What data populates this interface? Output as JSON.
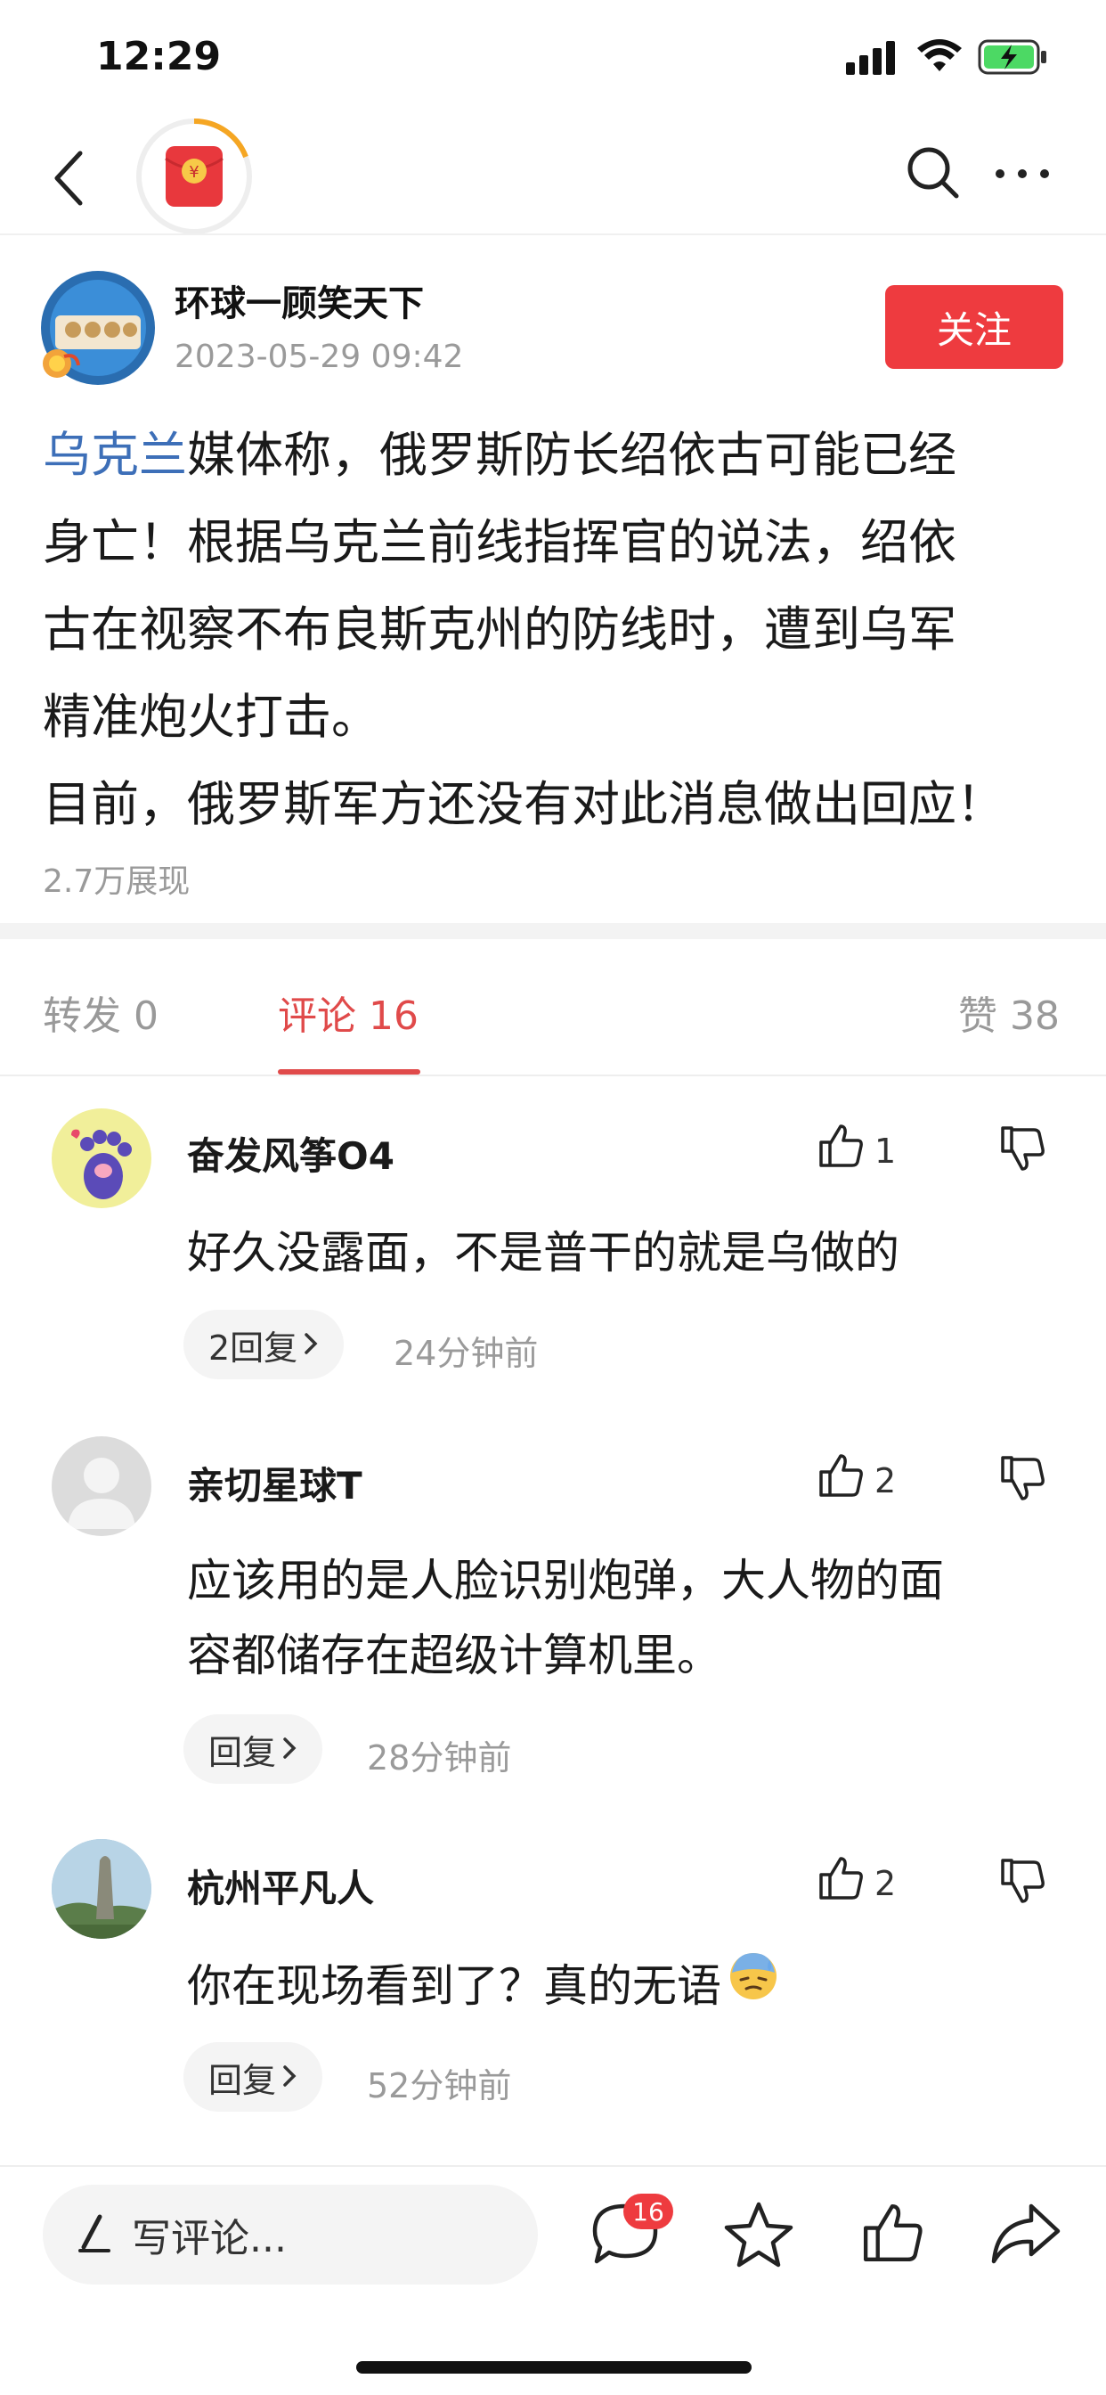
{
  "status_bar": {
    "time": "12:29"
  },
  "post": {
    "author": "环球一顾笑天下",
    "timestamp": "2023-05-29 09:42",
    "follow_label": "关注",
    "body_link": "乌克兰",
    "body_line1_rest": "媒体称，俄罗斯防长绍依古可能已经",
    "body_line2": "身亡！根据乌克兰前线指挥官的说法，绍依",
    "body_line3": "古在视察不布良斯克州的防线时，遭到乌军",
    "body_line4": "精准炮火打击。",
    "body_line5": "目前，俄罗斯军方还没有对此消息做出回应！",
    "views": "2.7万展现"
  },
  "tabs": {
    "repost": "转发 0",
    "comments": "评论 16",
    "likes": "赞 38"
  },
  "comments": [
    {
      "name": "奋发风筝O4",
      "text": "好久没露面，不是普干的就是乌做的",
      "likes": "1",
      "reply": "2回复",
      "time": "24分钟前"
    },
    {
      "name": "亲切星球T",
      "text_line1": "应该用的是人脸识别炮弹，大人物的面",
      "text_line2": "容都储存在超级计算机里。",
      "likes": "2",
      "reply": "回复",
      "time": "28分钟前"
    },
    {
      "name": "杭州平凡人",
      "text": "你在现场看到了？真的无语",
      "likes": "2",
      "reply": "回复",
      "time": "52分钟前"
    }
  ],
  "bottom_bar": {
    "write_placeholder": "写评论...",
    "comment_badge": "16"
  },
  "colors": {
    "accent_red": "#ee3b3f",
    "link_blue": "#3d6fb8"
  }
}
